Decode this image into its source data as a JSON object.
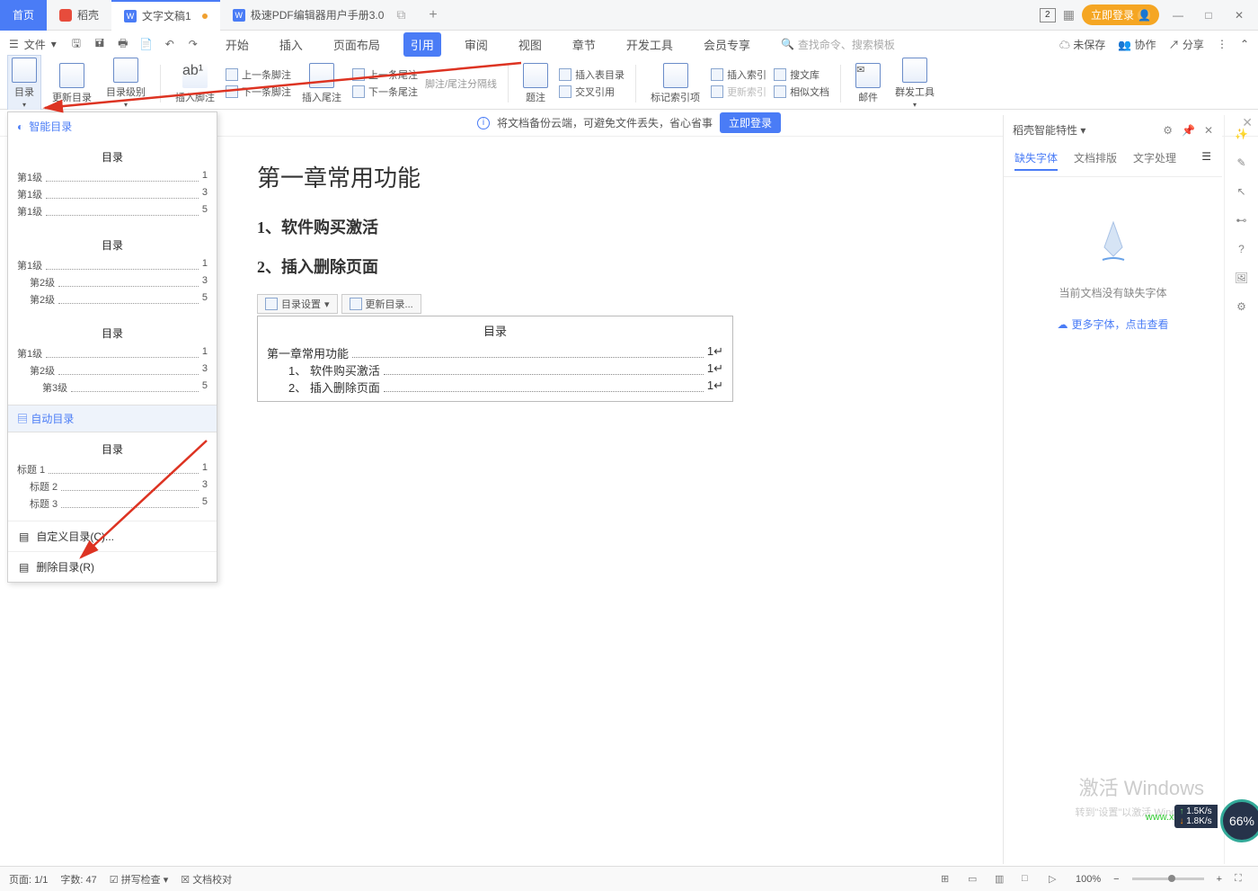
{
  "titlebar": {
    "home": "首页",
    "docker": "稻壳",
    "doc1": "文字文稿1",
    "doc2": "极速PDF编辑器用户手册3.0",
    "login": "立即登录",
    "badge_count": "2"
  },
  "menu": {
    "file": "文件",
    "tabs": [
      "开始",
      "插入",
      "页面布局",
      "引用",
      "审阅",
      "视图",
      "章节",
      "开发工具",
      "会员专享"
    ],
    "active_index": 3,
    "search_placeholder": "查找命令、搜索模板",
    "unsaved": "未保存",
    "collab": "协作",
    "share": "分享"
  },
  "ribbon": {
    "toc": "目录",
    "update_toc": "更新目录",
    "toc_level": "目录级别",
    "insert_footnote": "插入脚注",
    "prev_footnote": "上一条脚注",
    "next_footnote": "下一条脚注",
    "insert_endnote": "插入尾注",
    "prev_endnote": "上一条尾注",
    "next_endnote": "下一条尾注",
    "footnote_divider": "脚注/尾注分隔线",
    "caption": "题注",
    "insert_table_toc": "插入表目录",
    "crossref": "交叉引用",
    "mark_index": "标记索引项",
    "insert_index": "插入索引",
    "update_index": "更新索引",
    "search_lib": "搜文库",
    "similar_docs": "相似文档",
    "mail": "邮件",
    "group_tools": "群发工具"
  },
  "banner": {
    "text": "将文档备份云端，可避免文件丢失，省心省事",
    "btn": "立即登录"
  },
  "toc_panel": {
    "smart": "智能目录",
    "toc_label": "目录",
    "s1": [
      {
        "lbl": "第1级",
        "pg": "1"
      },
      {
        "lbl": "第1级",
        "pg": "3"
      },
      {
        "lbl": "第1级",
        "pg": "5"
      }
    ],
    "s2": [
      {
        "lbl": "第1级",
        "pg": "1",
        "ind": 0
      },
      {
        "lbl": "第2级",
        "pg": "3",
        "ind": 1
      },
      {
        "lbl": "第2级",
        "pg": "5",
        "ind": 1
      }
    ],
    "s3": [
      {
        "lbl": "第1级",
        "pg": "1",
        "ind": 0
      },
      {
        "lbl": "第2级",
        "pg": "3",
        "ind": 1
      },
      {
        "lbl": "第3级",
        "pg": "5",
        "ind": 2
      }
    ],
    "auto": "自动目录",
    "s4": [
      {
        "lbl": "标题 1",
        "pg": "1",
        "ind": 0
      },
      {
        "lbl": "标题 2",
        "pg": "3",
        "ind": 1
      },
      {
        "lbl": "标题 3",
        "pg": "5",
        "ind": 1
      }
    ],
    "custom": "自定义目录(C)...",
    "delete": "删除目录(R)"
  },
  "document": {
    "h1": "第一章常用功能",
    "h2a": "1、软件购买激活",
    "h2b": "2、插入删除页面",
    "toc_settings": "目录设置",
    "toc_update": "更新目录...",
    "toc_title": "目录",
    "lines": [
      {
        "nm": "第一章常用功能",
        "pg": "1",
        "ind": 0
      },
      {
        "nm": "1、 软件购买激活",
        "pg": "1",
        "ind": 1
      },
      {
        "nm": "2、 插入删除页面",
        "pg": "1",
        "ind": 1
      }
    ]
  },
  "right_panel": {
    "title": "稻壳智能特性",
    "tabs": [
      "缺失字体",
      "文档排版",
      "文字处理"
    ],
    "empty": "当前文档没有缺失字体",
    "link": "更多字体，点击查看"
  },
  "statusbar": {
    "page": "页面: 1/1",
    "words": "字数: 47",
    "spell": "拼写检查",
    "proof": "文档校对",
    "zoom": "100%"
  },
  "watermark": {
    "activate": "激活 Windows",
    "goto": "转到\"设置\"以激活 Windows。",
    "site": "www.xz7.com",
    "speed1": "1.5K/s",
    "speed2": "1.8K/s",
    "pct": "66%"
  }
}
